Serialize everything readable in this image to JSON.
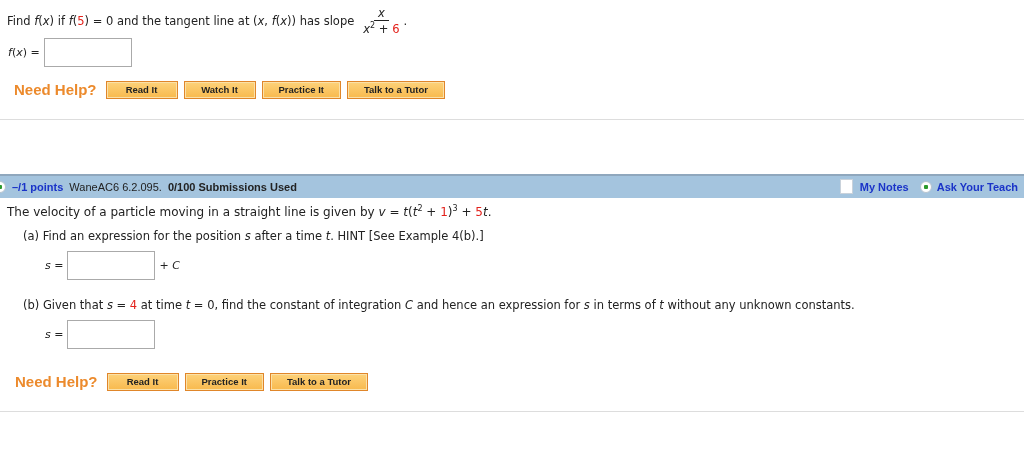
{
  "question_1": {
    "prompt": [
      {
        "kind": "text",
        "text": "Find *f*(*x*) if *f*(",
        "red": false
      },
      {
        "kind": "text",
        "text": "5",
        "red": true
      },
      {
        "kind": "text",
        "text": ") = 0 and the tangent line at (*x*, *f*(*x*)) has slope ",
        "red": false
      },
      {
        "kind": "fraction",
        "numerator": [
          {
            "kind": "text",
            "text": "*x*",
            "red": false
          }
        ],
        "denominator": [
          {
            "kind": "text",
            "text": "*x*$^{2}$ + ",
            "red": false
          },
          {
            "kind": "text",
            "text": "6",
            "red": true
          }
        ]
      },
      {
        "kind": "text",
        "text": ".",
        "red": false
      }
    ],
    "answers": [
      {
        "label": "*f*(*x*) ="
      }
    ],
    "help": {
      "label": "Need Help?",
      "buttons": [
        "Read It",
        "Watch It",
        "Practice It",
        "Talk to a Tutor"
      ]
    }
  },
  "question_2": {
    "header": {
      "points": "–/1 points",
      "source": "WaneAC6 6.2.095.",
      "submissions": "0/100 Submissions Used",
      "links": [
        "My Notes",
        "Ask Your Teach"
      ]
    },
    "prompt": [
      {
        "kind": "text",
        "text": "The velocity of a particle moving in a straight line is given by  *v* = *t*(*t*$^{2}$ + ",
        "red": false
      },
      {
        "kind": "text",
        "text": "1",
        "red": true
      },
      {
        "kind": "text",
        "text": ")$^{3}$ + ",
        "red": false
      },
      {
        "kind": "text",
        "text": "5",
        "red": true
      },
      {
        "kind": "text",
        "text": "*t*.",
        "red": false
      }
    ],
    "parts": [
      {
        "prompt": [
          {
            "kind": "text",
            "text": "(a) Find an expression for the position *s* after a time *t*. HINT [See Example 4(b).]",
            "red": false
          }
        ],
        "answers": [
          {
            "label": "*s* =",
            "suffix": "+ *C*"
          }
        ]
      },
      {
        "prompt": [
          {
            "kind": "text",
            "text": "(b) Given that *s* = ",
            "red": false
          },
          {
            "kind": "text",
            "text": "4",
            "red": true
          },
          {
            "kind": "text",
            "text": " at time *t* = 0, find the constant of integration *C* and hence an expression for *s* in terms of *t* without any unknown constants.",
            "red": false
          }
        ],
        "answers": [
          {
            "label": "*s* ="
          }
        ]
      }
    ],
    "help": {
      "label": "Need Help?",
      "buttons": [
        "Read It",
        "Practice It",
        "Talk to a Tutor"
      ]
    }
  }
}
